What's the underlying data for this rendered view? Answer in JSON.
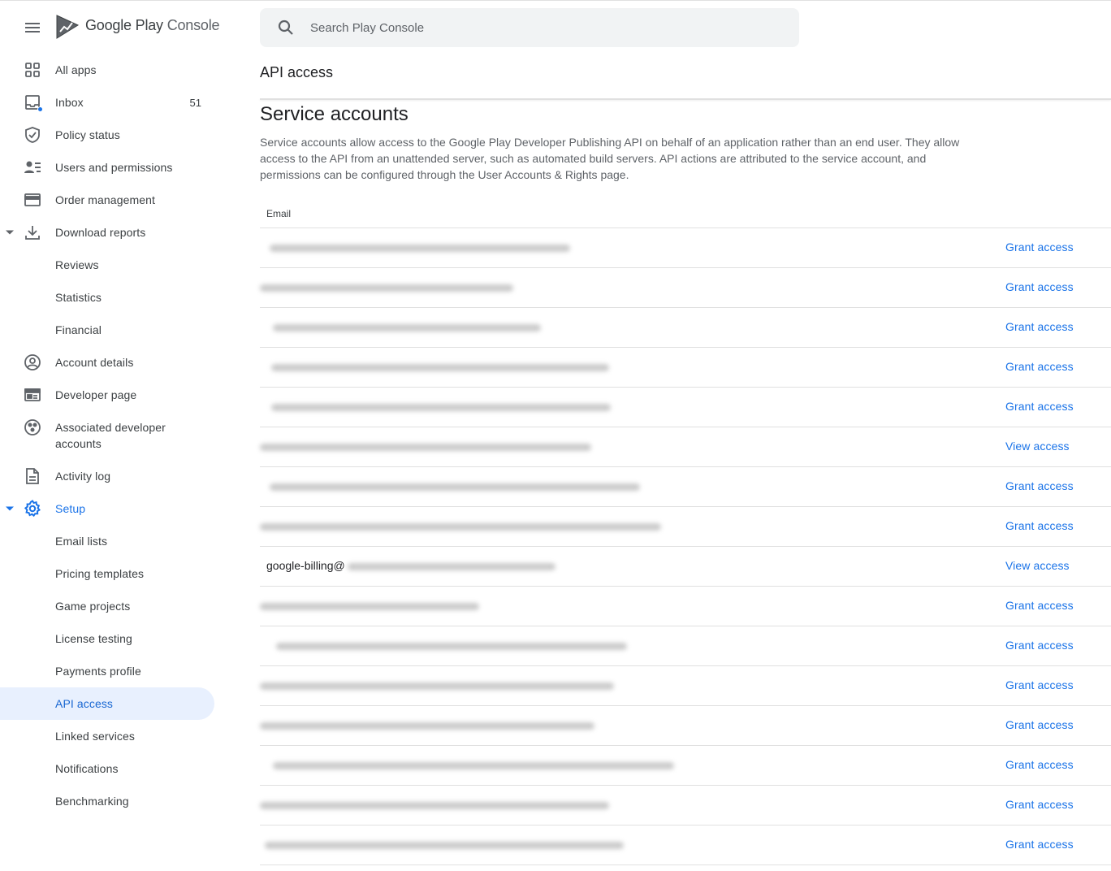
{
  "brand": {
    "google": "Google Play",
    "console": "Console"
  },
  "search": {
    "placeholder": "Search Play Console"
  },
  "sidebar": {
    "items": [
      {
        "label": "All apps",
        "icon": "grid-icon"
      },
      {
        "label": "Inbox",
        "icon": "inbox-icon",
        "count": "51"
      },
      {
        "label": "Policy status",
        "icon": "shield-icon"
      },
      {
        "label": "Users and permissions",
        "icon": "people-icon"
      },
      {
        "label": "Order management",
        "icon": "credit-card-icon"
      },
      {
        "label": "Download reports",
        "icon": "download-icon"
      },
      {
        "label": "Reviews"
      },
      {
        "label": "Statistics"
      },
      {
        "label": "Financial"
      },
      {
        "label": "Account details",
        "icon": "account-circle-icon"
      },
      {
        "label": "Developer page",
        "icon": "web-page-icon"
      },
      {
        "label": "Associated developer accounts",
        "icon": "linked-accounts-icon"
      },
      {
        "label": "Activity log",
        "icon": "document-icon"
      },
      {
        "label": "Setup",
        "icon": "gear-icon"
      },
      {
        "label": "Email lists"
      },
      {
        "label": "Pricing templates"
      },
      {
        "label": "Game projects"
      },
      {
        "label": "License testing"
      },
      {
        "label": "Payments profile"
      },
      {
        "label": "API access"
      },
      {
        "label": "Linked services"
      },
      {
        "label": "Notifications"
      },
      {
        "label": "Benchmarking"
      }
    ]
  },
  "main": {
    "page_title": "API access",
    "section_title": "Service accounts",
    "section_description": "Service accounts allow access to the Google Play Developer Publishing API on behalf of an application rather than an end user. They allow access to the API from an unattended server, such as automated build servers. API actions are attributed to the service account, and permissions can be configured through the User Accounts & Rights page.",
    "table": {
      "columns": [
        "Email"
      ],
      "rows": [
        {
          "email": "",
          "action": "Grant access"
        },
        {
          "email": "",
          "action": "Grant access"
        },
        {
          "email": "",
          "action": "Grant access"
        },
        {
          "email": "",
          "action": "Grant access"
        },
        {
          "email": "",
          "action": "Grant access"
        },
        {
          "email": "",
          "action": "View access"
        },
        {
          "email": "",
          "action": "Grant access"
        },
        {
          "email": "",
          "action": "Grant access"
        },
        {
          "email": "google-billing@",
          "action": "View access"
        },
        {
          "email": "",
          "action": "Grant access"
        },
        {
          "email": "",
          "action": "Grant access"
        },
        {
          "email": "",
          "action": "Grant access"
        },
        {
          "email": "",
          "action": "Grant access"
        },
        {
          "email": "",
          "action": "Grant access"
        },
        {
          "email": "",
          "action": "Grant access"
        },
        {
          "email": "",
          "action": "Grant access"
        }
      ]
    }
  },
  "colors": {
    "accent": "#1a73e8",
    "active_bg": "#e8f0fe",
    "text": "#202124",
    "muted": "#5f6368"
  }
}
